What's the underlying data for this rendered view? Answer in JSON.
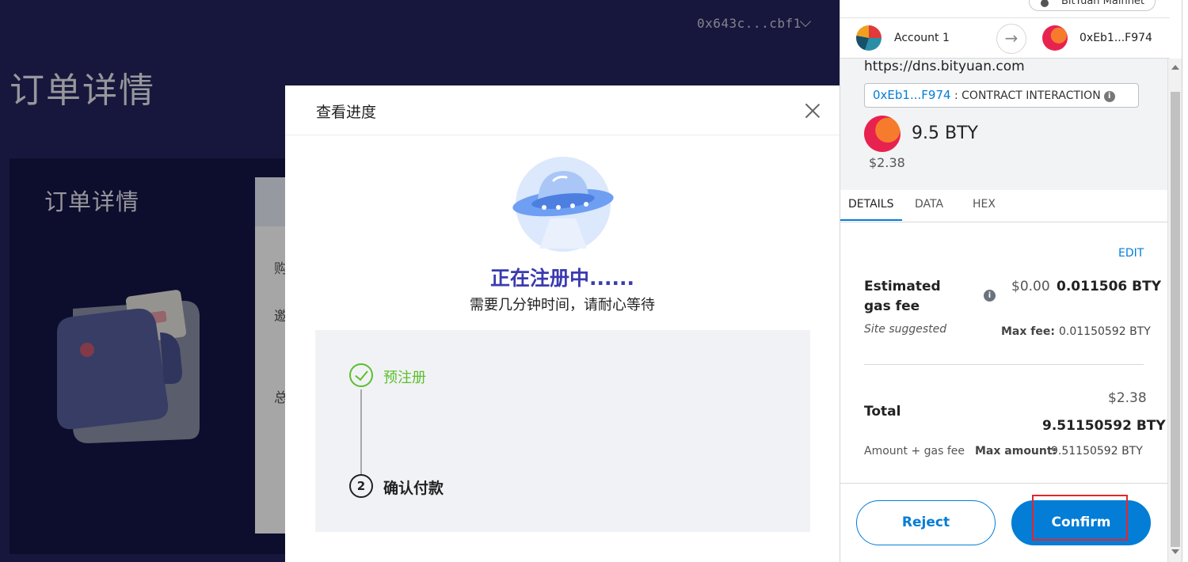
{
  "background": {
    "account_short": "0x643c...cbf1",
    "page_title": "订单详情",
    "card_title": "订单详情",
    "panel_chars": [
      "购",
      "邀",
      "总"
    ]
  },
  "modal": {
    "title": "查看进度",
    "status_title": "正在注册中......",
    "status_subtitle": "需要几分钟时间，请耐心等待",
    "steps": [
      {
        "label": "预注册",
        "state": "done"
      },
      {
        "number": "2",
        "label": "确认付款",
        "state": "pending"
      }
    ]
  },
  "metamask": {
    "network": "BitYuan Mainnet",
    "from_account": "Account 1",
    "to_account": "0xEb1...F974",
    "origin": "https://dns.bityuan.com",
    "contract_addr": "0xEb1...F974",
    "contract_label": " : CONTRACT INTERACTION",
    "amount": "9.5 BTY",
    "amount_usd": "$2.38",
    "tabs": [
      "DETAILS",
      "DATA",
      "HEX"
    ],
    "edit": "EDIT",
    "gas_label": "Estimated gas fee",
    "gas_usd": "$0.00",
    "gas_bty": "0.011506 BTY",
    "site_suggested": "Site suggested",
    "max_fee_label": "Max fee:",
    "max_fee_value": "0.01150592 BTY",
    "total_usd": "$2.38",
    "total_label": "Total",
    "total_bty": "9.51150592 BTY",
    "amount_gas_label": "Amount + gas fee",
    "max_amount_label": "Max amount:",
    "max_amount_value": "9.51150592 BTY",
    "reject": "Reject",
    "confirm": "Confirm"
  },
  "colors": {
    "background_navy": "#24245e",
    "accent_blue": "#037dd6",
    "success_green": "#5cbf2a",
    "status_title_blue": "#3b3bb0",
    "highlight_red": "#e3262b"
  },
  "icons": [
    "chevron-down-icon",
    "close-icon",
    "ufo-illustration",
    "wallet-illustration",
    "check-circle-icon",
    "arrow-right-icon",
    "info-icon"
  ]
}
